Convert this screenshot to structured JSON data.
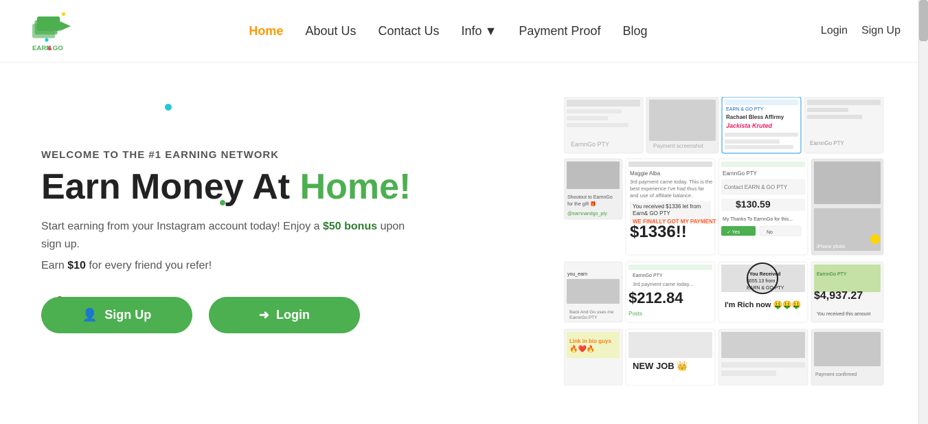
{
  "logo": {
    "text": "EARN&GO",
    "alt": "EarnnGo Logo"
  },
  "nav": {
    "items": [
      {
        "label": "Home",
        "active": true
      },
      {
        "label": "About Us",
        "active": false
      },
      {
        "label": "Contact Us",
        "active": false
      },
      {
        "label": "Info",
        "active": false,
        "has_dropdown": true
      },
      {
        "label": "Payment Proof",
        "active": false
      },
      {
        "label": "Blog",
        "active": false
      }
    ]
  },
  "auth": {
    "login_label": "Login",
    "signup_label": "Sign Up"
  },
  "hero": {
    "subtitle": "WELCOME TO THE #1 EARNING NETWORK",
    "headline_part1": "Earn Money At ",
    "headline_highlight": "Home!",
    "description": "Start earning from your Instagram account today! Enjoy a ",
    "description_bold": "$50 bonus",
    "description_end": " upon sign up.",
    "referral_text": "Earn ",
    "referral_amount": "$10",
    "referral_end": " for every friend you refer!",
    "btn_signup": "Sign Up",
    "btn_login": "Login",
    "money_amounts": [
      "$1336!!",
      "$212.84",
      "$130.59",
      "$4,937.27"
    ]
  }
}
